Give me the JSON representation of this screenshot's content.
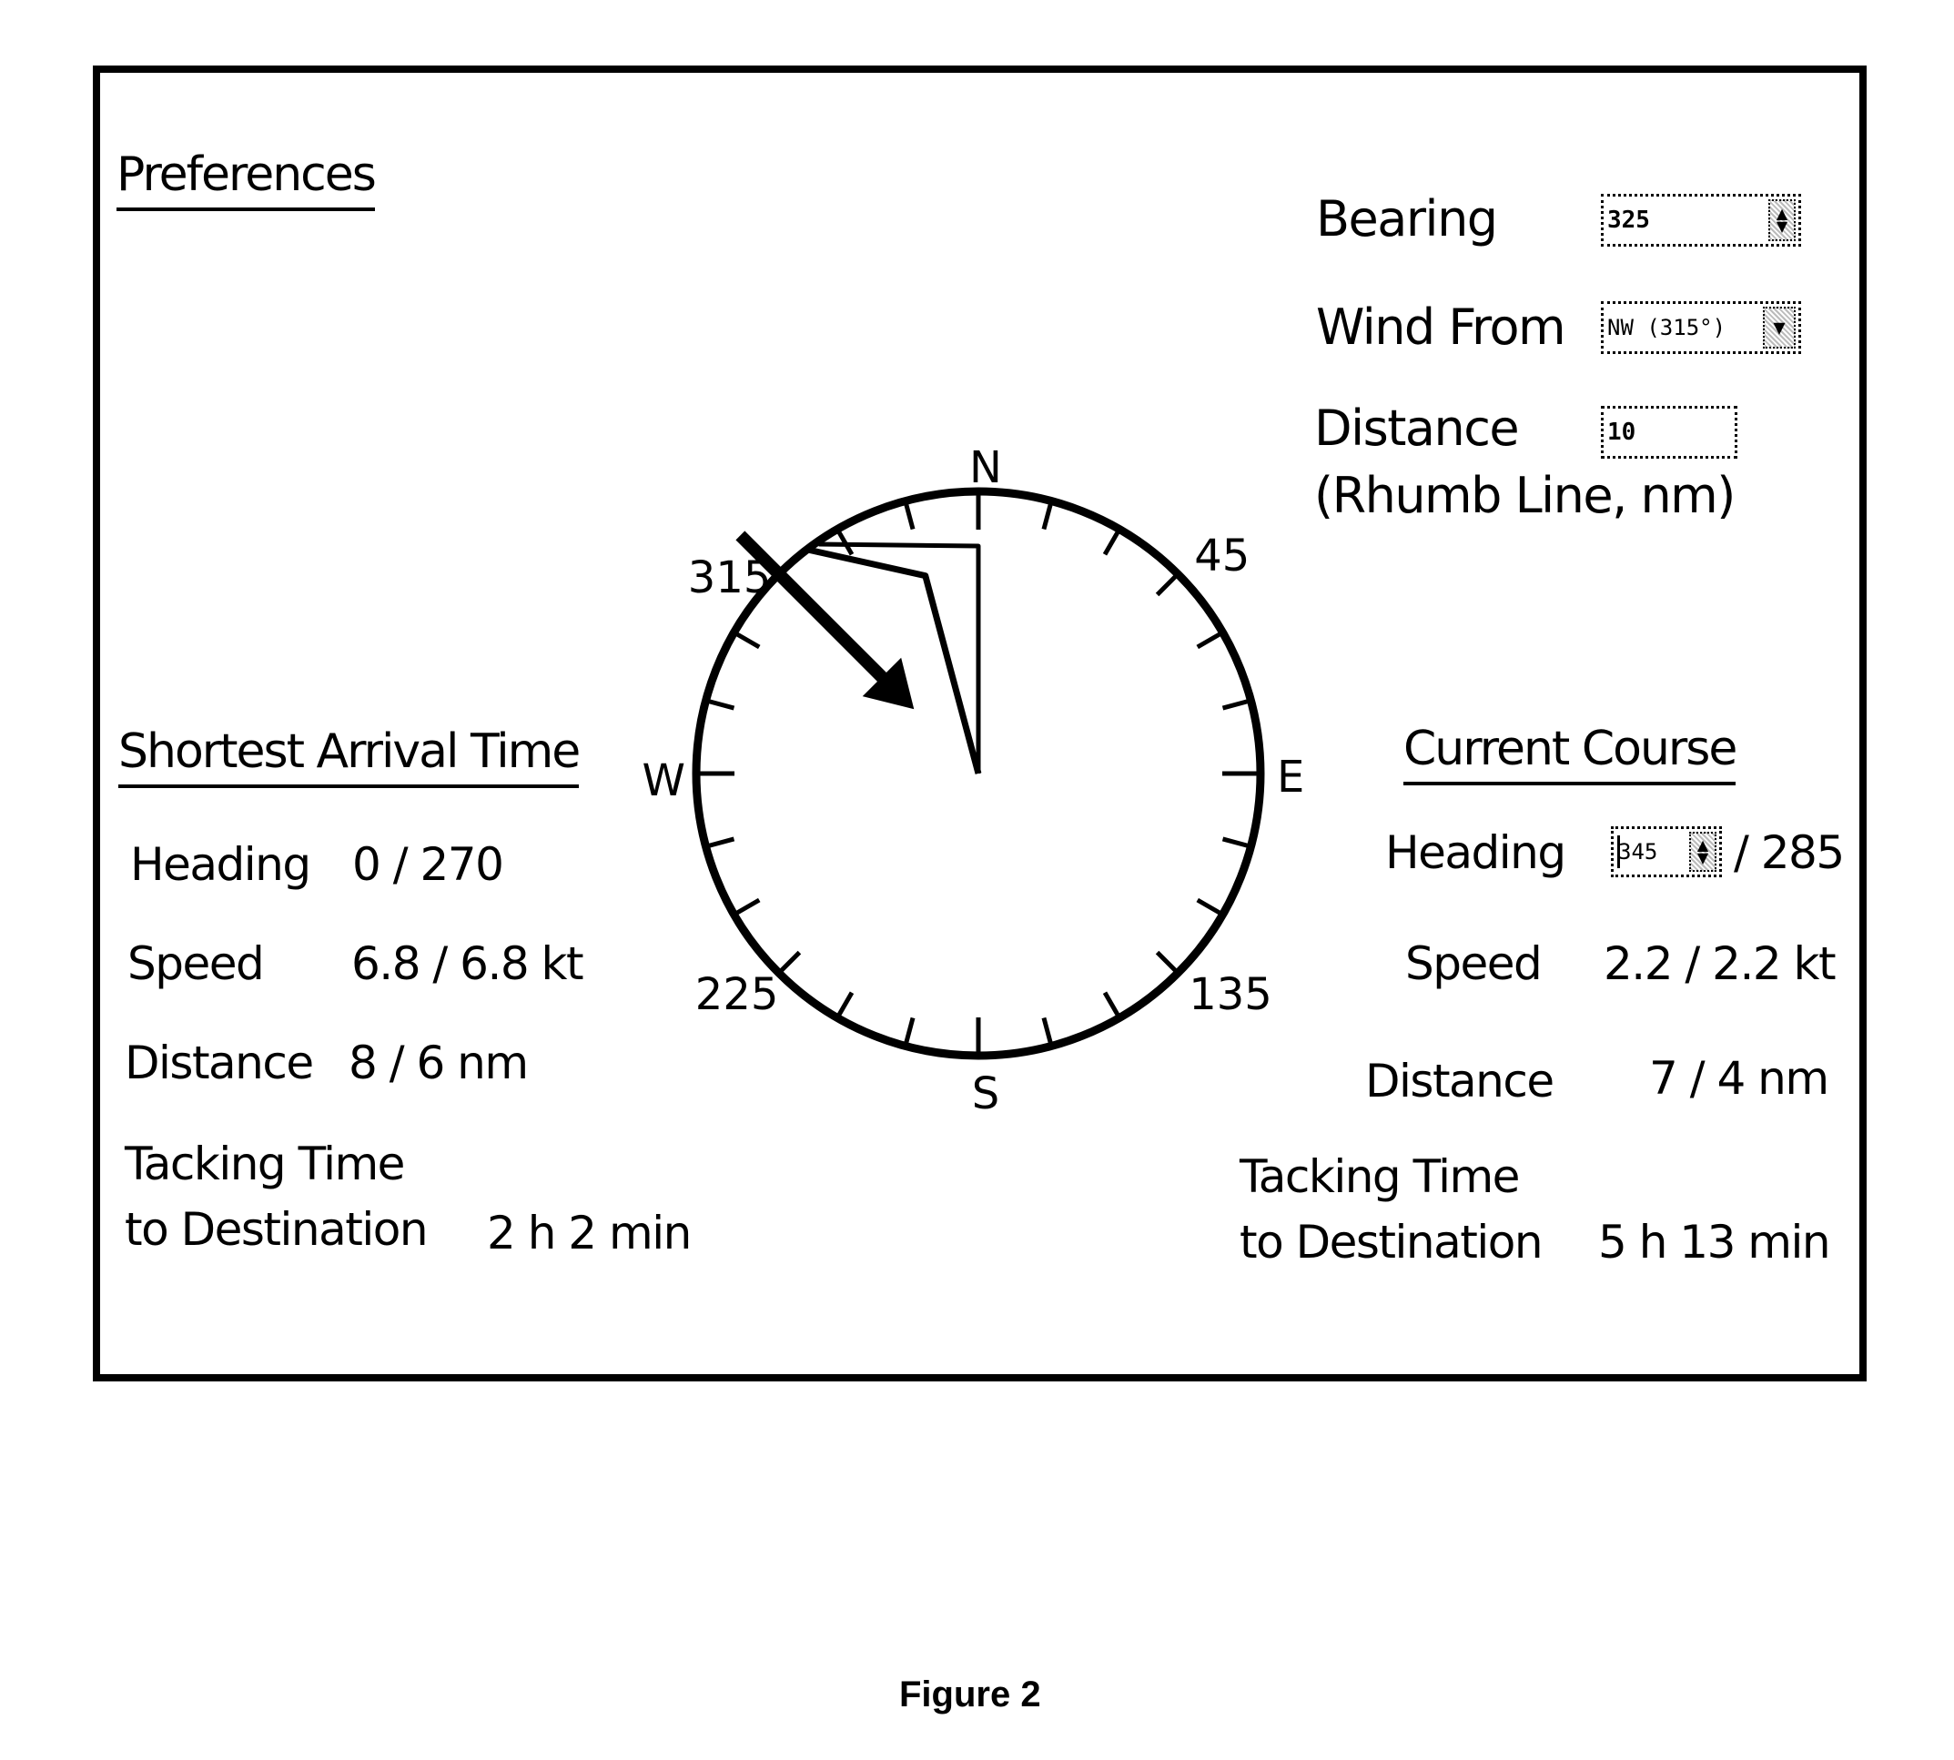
{
  "preferences": {
    "title": "Preferences",
    "bearing": {
      "label": "Bearing",
      "value": "325",
      "control": "spinner"
    },
    "wind_from": {
      "label": "Wind From",
      "value": "NW (315°)",
      "control": "dropdown"
    },
    "distance": {
      "label_line1": "Distance",
      "label_line2": "(Rhumb Line, nm)",
      "value": "10"
    }
  },
  "compass": {
    "cardinal_labels": {
      "n": "N",
      "e": "E",
      "s": "S",
      "w": "W"
    },
    "degree_labels": [
      {
        "text": "45",
        "bearing": 45
      },
      {
        "text": "135",
        "bearing": 135
      },
      {
        "text": "225",
        "bearing": 225
      },
      {
        "text": "315",
        "bearing": 315
      }
    ],
    "tick_interval_deg": 15,
    "wind_from_deg": 315,
    "rhumb_line_bearing_deg": 325,
    "course_heading_deg": 345,
    "tack_heading_deg": 285,
    "icons": {
      "wind_arrow": "wind-arrow-icon"
    }
  },
  "shortest_arrival": {
    "title": "Shortest Arrival Time",
    "heading": {
      "label": "Heading",
      "value": "0 / 270"
    },
    "speed": {
      "label": "Speed",
      "value": "6.8 / 6.8 kt"
    },
    "distance": {
      "label": "Distance",
      "value": "8 / 6 nm"
    },
    "tacking": {
      "label_line1": "Tacking Time",
      "label_line2": "to Destination",
      "value": "2 h 2 min"
    }
  },
  "current_course": {
    "title": "Current Course",
    "heading": {
      "label": "Heading",
      "input_value": "345",
      "suffix": "/ 285"
    },
    "speed": {
      "label": "Speed",
      "value": "2.2 / 2.2 kt"
    },
    "distance": {
      "label": "Distance",
      "value": "7 / 4 nm"
    },
    "tacking": {
      "label_line1": "Tacking Time",
      "label_line2": "to Destination",
      "value": "5 h 13 min"
    }
  },
  "caption": "Figure 2"
}
